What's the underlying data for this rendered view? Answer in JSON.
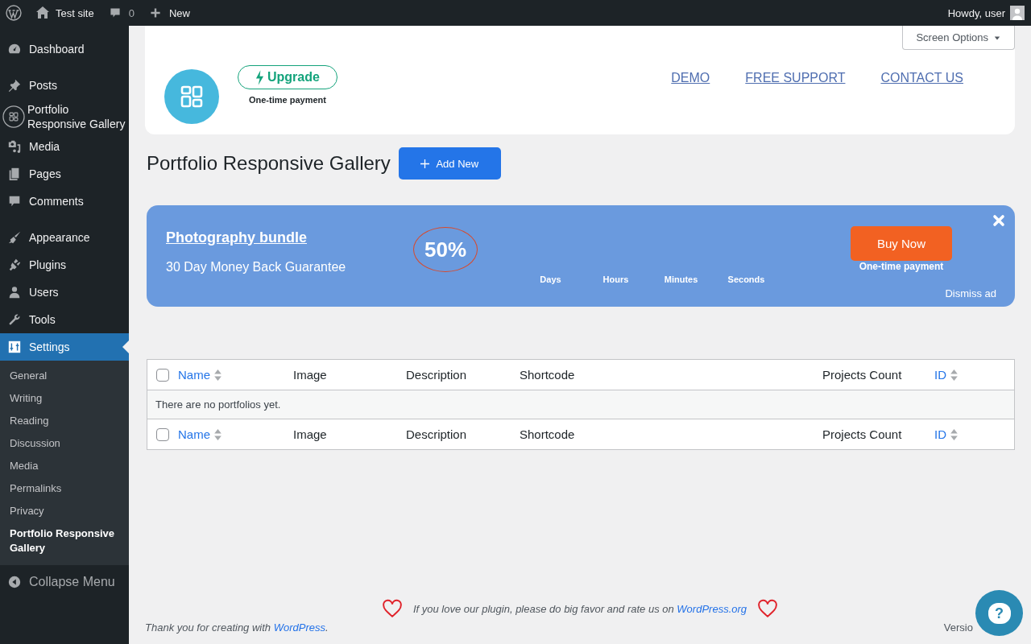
{
  "admin_bar": {
    "items": [
      {
        "kind": "logo"
      },
      {
        "kind": "site",
        "label": "Test site"
      },
      {
        "kind": "comments",
        "label": "0"
      },
      {
        "kind": "new",
        "label": "New"
      }
    ],
    "greeting": "Howdy, user"
  },
  "sidebar": {
    "groups": [
      [
        {
          "kind": "dashboard",
          "label": "Dashboard",
          "selected": false
        }
      ],
      [
        {
          "kind": "posts",
          "label": "Posts",
          "selected": false
        },
        {
          "kind": "portfolio",
          "label": "Portfolio Responsive Gallery",
          "selected": false
        },
        {
          "kind": "media",
          "label": "Media",
          "selected": false
        },
        {
          "kind": "pages",
          "label": "Pages",
          "selected": false
        },
        {
          "kind": "comments",
          "label": "Comments",
          "selected": false
        }
      ],
      [
        {
          "kind": "appearance",
          "label": "Appearance",
          "selected": false
        },
        {
          "kind": "plugins",
          "label": "Plugins",
          "selected": false
        },
        {
          "kind": "users",
          "label": "Users",
          "selected": false
        },
        {
          "kind": "tools",
          "label": "Tools",
          "selected": false
        },
        {
          "kind": "settings",
          "label": "Settings",
          "selected": true,
          "children": [
            {
              "label": "General",
              "selected": false
            },
            {
              "label": "Writing",
              "selected": false
            },
            {
              "label": "Reading",
              "selected": false
            },
            {
              "label": "Discussion",
              "selected": false
            },
            {
              "label": "Media",
              "selected": false
            },
            {
              "label": "Permalinks",
              "selected": false
            },
            {
              "label": "Privacy",
              "selected": false
            },
            {
              "label": "Portfolio Responsive Gallery",
              "selected": true
            }
          ]
        }
      ]
    ],
    "collapse": "Collapse Menu"
  },
  "screen_options": "Screen Options",
  "header": {
    "upgrade": "Upgrade",
    "upgrade_note": "One-time payment",
    "links": [
      "DEMO",
      "FREE SUPPORT",
      "CONTACT US"
    ]
  },
  "page_title": "Portfolio Responsive Gallery",
  "add_new": "Add New",
  "promo": {
    "title": "Photography bundle",
    "subtitle": "30 Day Money Back Guarantee",
    "discount": "50%",
    "countdown": [
      "Days",
      "Hours",
      "Minutes",
      "Seconds"
    ],
    "buy": "Buy Now",
    "buy_note": "One-time payment",
    "dismiss": "Dismiss ad"
  },
  "table": {
    "columns": [
      {
        "label": "Name",
        "sortable": true
      },
      {
        "label": "Image",
        "sortable": false
      },
      {
        "label": "Description",
        "sortable": false
      },
      {
        "label": "Shortcode",
        "sortable": false
      },
      {
        "label": "Projects Count",
        "sortable": false
      },
      {
        "label": "ID",
        "sortable": true
      }
    ],
    "footer_columns": [
      {
        "label": "Name",
        "sortable": true
      },
      {
        "label": "Image",
        "sortable": false
      },
      {
        "label": "Description",
        "sortable": false
      },
      {
        "label": "Shortcode",
        "sortable": false
      },
      {
        "label": "Projects Count",
        "sortable": false
      },
      {
        "label": "ID",
        "sortable": true
      }
    ],
    "header_checked": false,
    "footer_checked": false,
    "empty": "There are no portfolios yet."
  },
  "footer": {
    "rating_text": "If you love our plugin, please do big favor and rate us on",
    "rating_link": "WordPress.org",
    "thanks_before": "Thank you for creating with",
    "thanks_link": "WordPress",
    "thanks_after": ".",
    "version": "Versio"
  },
  "help": "?"
}
